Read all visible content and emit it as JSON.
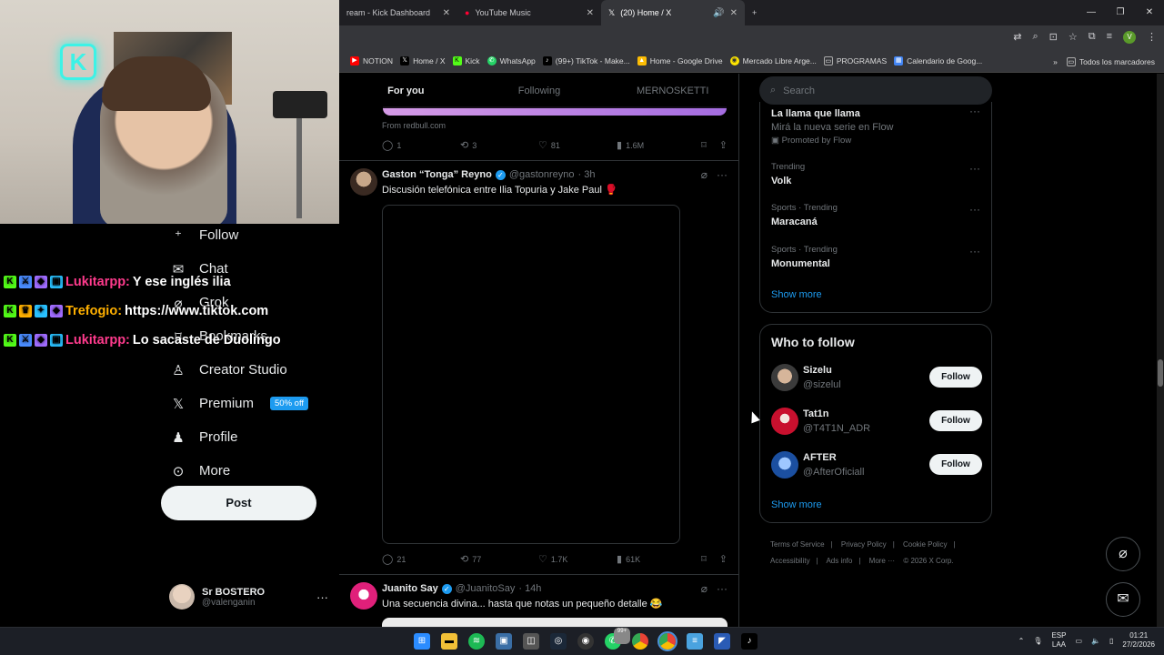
{
  "browser": {
    "tabs": [
      {
        "label": "ream - Kick Dashboard",
        "active": false
      },
      {
        "label": "YouTube Music",
        "active": false
      },
      {
        "label": "(20) Home / X",
        "active": true
      }
    ],
    "new_tab": "+",
    "bookmarks": [
      {
        "label": "NOTION",
        "icon": "youtube-icon",
        "color": "#ff0000"
      },
      {
        "label": "Home / X",
        "icon": "x-icon",
        "color": "#000000"
      },
      {
        "label": "Kick",
        "icon": "kick-icon",
        "color": "#53fc18"
      },
      {
        "label": "WhatsApp",
        "icon": "whatsapp-icon",
        "color": "#25d366"
      },
      {
        "label": "(99+) TikTok - Make...",
        "icon": "tiktok-icon",
        "color": "#000000"
      },
      {
        "label": "Home - Google Drive",
        "icon": "drive-icon",
        "color": "#fbbc04"
      },
      {
        "label": "Mercado Libre Arge...",
        "icon": "mercadolibre-icon",
        "color": "#ffe600"
      },
      {
        "label": "PROGRAMAS",
        "icon": "folder-icon",
        "color": "#888888"
      },
      {
        "label": "Calendario de Goog...",
        "icon": "calendar-icon",
        "color": "#4285f4"
      }
    ],
    "bookmarks_overflow": "»",
    "all_bookmarks": "Todos los marcadores",
    "profile_initial": "V"
  },
  "stream_chat": [
    {
      "user": "Lukitarpp:",
      "message": "Y ese inglés ilia",
      "name_color": "#ff3b8d"
    },
    {
      "user": "Trefogio:",
      "message": "https://www.tiktok.com",
      "name_color": "#ffb000"
    },
    {
      "user": "Lukitarpp:",
      "message": "Lo sacaste de Duolingo",
      "name_color": "#ff3b8d"
    }
  ],
  "nav": {
    "items": [
      {
        "label": "Follow",
        "icon": "follow-icon"
      },
      {
        "label": "Chat",
        "icon": "chat-icon"
      },
      {
        "label": "Grok",
        "icon": "grok-icon"
      },
      {
        "label": "Bookmarks",
        "icon": "bookmark-icon"
      },
      {
        "label": "Creator Studio",
        "icon": "creator-studio-icon"
      },
      {
        "label": "Premium",
        "icon": "x-logo-icon"
      },
      {
        "label": "Profile",
        "icon": "profile-icon"
      },
      {
        "label": "More",
        "icon": "more-circle-icon"
      }
    ],
    "premium_badge": "50% off",
    "post_button": "Post",
    "account": {
      "name": "Sr BOSTERO",
      "handle": "@valenganin",
      "more": "···"
    }
  },
  "feed": {
    "tabs": [
      "For you",
      "Following",
      "MERNOSKETTI"
    ],
    "ad_source": "From redbull.com",
    "ad_stats": {
      "replies": "1",
      "reposts": "3",
      "likes": "81",
      "views": "1.6M"
    },
    "tweets": [
      {
        "name": "Gaston “Tonga” Reyno",
        "handle": "@gastonreyno",
        "time": "· 3h",
        "text": "Discusión telefónica entre Ilia Topuria y Jake Paul 🥊",
        "stats": {
          "replies": "21",
          "reposts": "77",
          "likes": "1.7K",
          "views": "61K"
        }
      },
      {
        "name": "Juanito Say",
        "handle": "@JuanitoSay",
        "time": "· 14h",
        "text": "Una secuencia divina... hasta que notas un pequeño detalle 😂"
      }
    ]
  },
  "sidebar": {
    "search_placeholder": "Search",
    "trends": [
      {
        "category": "",
        "title": "La llama que llama",
        "subtitle": "Mirá la nueva serie en Flow",
        "promo": "Promoted by Flow"
      },
      {
        "category": "Trending",
        "title": "Volk"
      },
      {
        "category": "Sports · Trending",
        "title": "Maracaná"
      },
      {
        "category": "Sports · Trending",
        "title": "Monumental"
      }
    ],
    "show_more": "Show more",
    "who_to_follow": {
      "title": "Who to follow",
      "users": [
        {
          "name": "Sizelu",
          "handle": "@sizelul",
          "button": "Follow"
        },
        {
          "name": "Tat1n",
          "handle": "@T4T1N_ADR",
          "button": "Follow"
        },
        {
          "name": "AFTER",
          "handle": "@AfterOficiall",
          "button": "Follow"
        }
      ],
      "show_more": "Show more"
    },
    "footer": [
      "Terms of Service",
      "|",
      "Privacy Policy",
      "|",
      "Cookie Policy",
      "|",
      "Accessibility",
      "|",
      "Ads info",
      "|",
      "More ···",
      "© 2026 X Corp."
    ]
  },
  "taskbar": {
    "lang_top": "ESP",
    "lang_bottom": "LAA",
    "time": "01:21",
    "date": "27/2/2026",
    "whatsapp_badge": "99+"
  }
}
